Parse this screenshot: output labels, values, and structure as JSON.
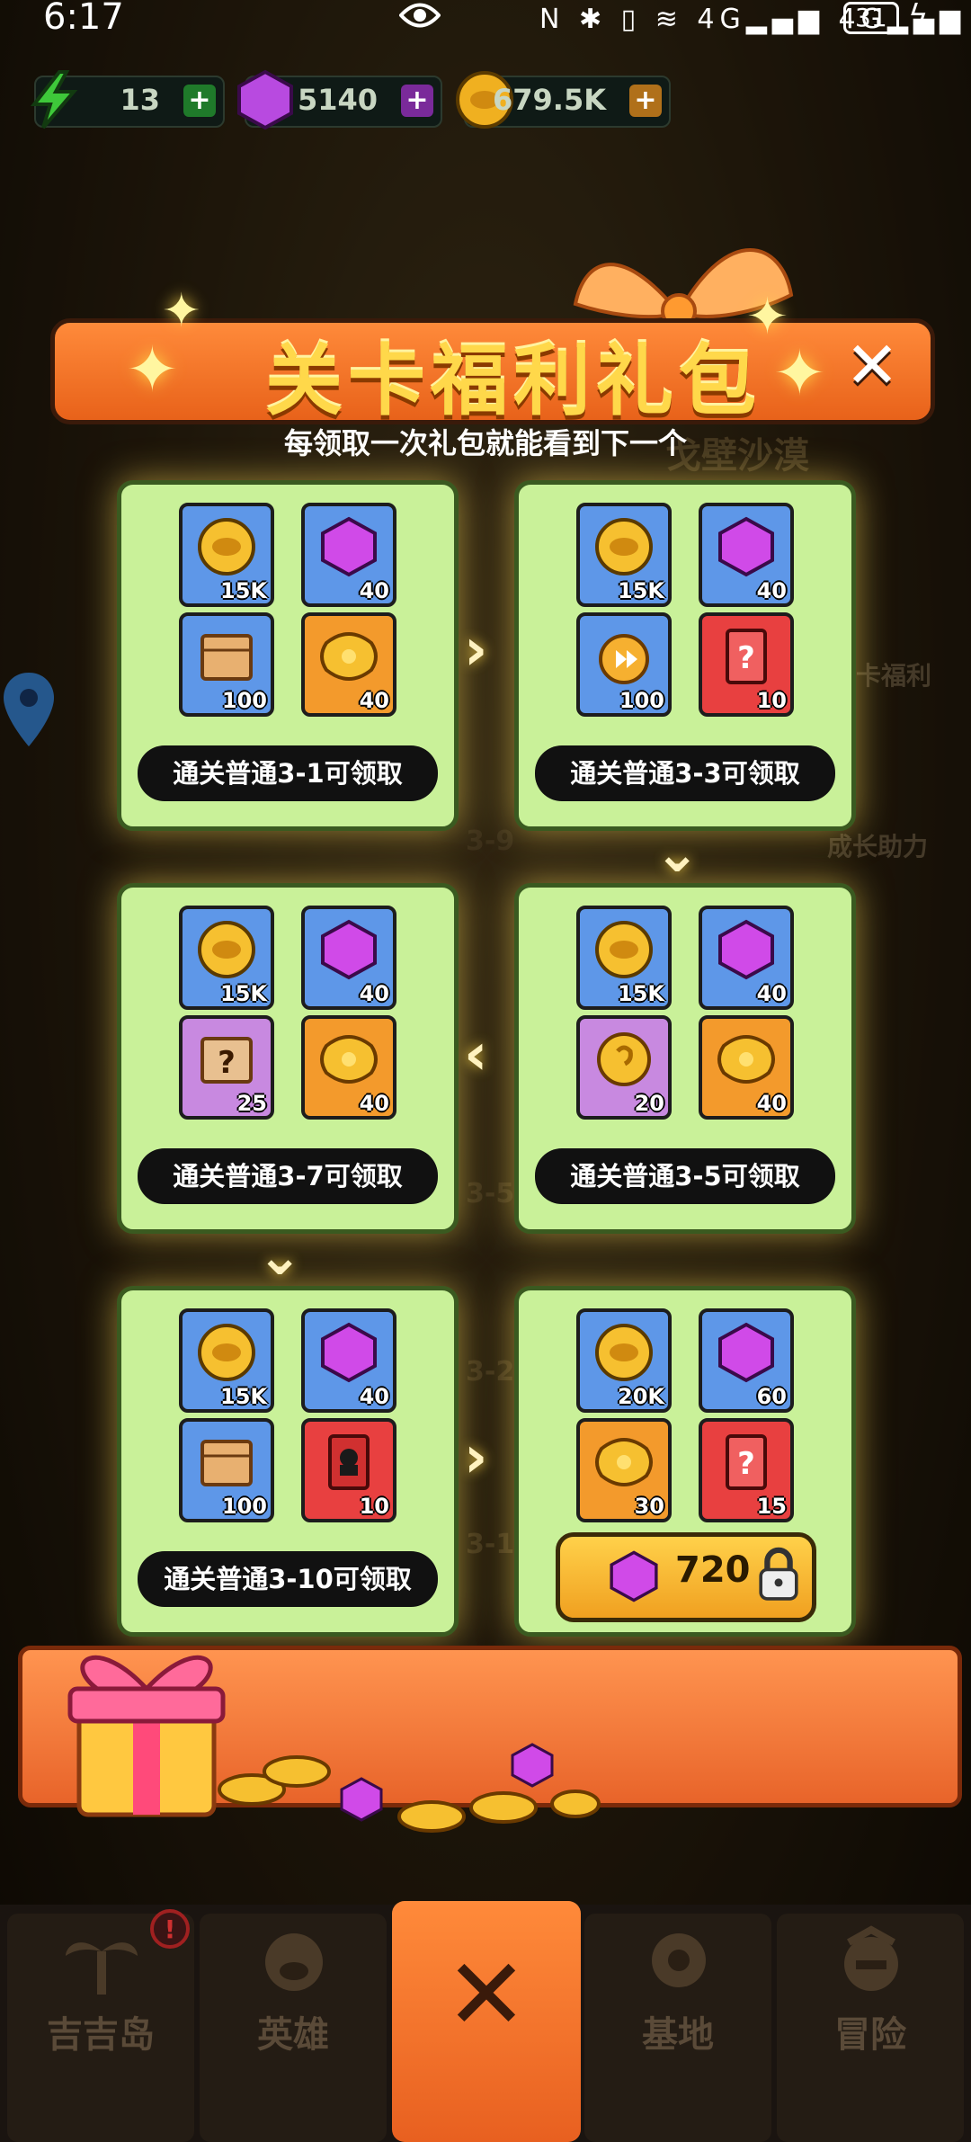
{
  "status_bar": {
    "time": "6:17",
    "battery": "31",
    "network": "4G"
  },
  "resources": {
    "energy": "13",
    "gems": "5140",
    "coins": "679.5K",
    "energy_color": "#3ec83a",
    "gem_color": "#b84ae0",
    "coin_color": "#f0b020"
  },
  "dialog": {
    "title": "关卡福利礼包",
    "subtitle": "每领取一次礼包就能看到下一个",
    "close_icon": "close-icon"
  },
  "background": {
    "area_name": "戈壁沙漠",
    "side_right_1": "卡福利",
    "side_right_2": "成长助力",
    "stage_labels": [
      "3-9",
      "3-5",
      "3-2",
      "3-1"
    ]
  },
  "packs": [
    {
      "condition": "通关普通3-1可领取",
      "items": [
        {
          "icon": "coin",
          "qty": "15K"
        },
        {
          "icon": "gem",
          "qty": "40"
        },
        {
          "icon": "crate",
          "qty": "100"
        },
        {
          "icon": "scroll-gold",
          "qty": "40"
        }
      ]
    },
    {
      "condition": "通关普通3-3可领取",
      "items": [
        {
          "icon": "coin",
          "qty": "15K"
        },
        {
          "icon": "gem",
          "qty": "40"
        },
        {
          "icon": "speedup-clock",
          "qty": "100"
        },
        {
          "icon": "mystery-card",
          "qty": "10"
        }
      ]
    },
    {
      "condition": "通关普通3-7可领取",
      "items": [
        {
          "icon": "coin",
          "qty": "15K"
        },
        {
          "icon": "gem",
          "qty": "40"
        },
        {
          "icon": "mystery-box",
          "qty": "25"
        },
        {
          "icon": "scroll-gold",
          "qty": "40"
        }
      ]
    },
    {
      "condition": "通关普通3-5可领取",
      "items": [
        {
          "icon": "coin",
          "qty": "15K"
        },
        {
          "icon": "gem",
          "qty": "40"
        },
        {
          "icon": "gold-medal",
          "qty": "20"
        },
        {
          "icon": "scroll-gold",
          "qty": "40"
        }
      ]
    },
    {
      "condition": "通关普通3-10可领取",
      "items": [
        {
          "icon": "coin",
          "qty": "15K"
        },
        {
          "icon": "gem",
          "qty": "40"
        },
        {
          "icon": "crate",
          "qty": "100"
        },
        {
          "icon": "hero-card",
          "qty": "10"
        }
      ]
    },
    {
      "price": "720",
      "locked": true,
      "items": [
        {
          "icon": "coin",
          "qty": "20K"
        },
        {
          "icon": "gem",
          "qty": "60"
        },
        {
          "icon": "scroll-gold",
          "qty": "30"
        },
        {
          "icon": "mystery-card",
          "qty": "15"
        }
      ]
    }
  ],
  "nav": {
    "items": [
      "吉吉岛",
      "英雄",
      "基地",
      "冒险"
    ],
    "center_icon": "close-icon"
  }
}
